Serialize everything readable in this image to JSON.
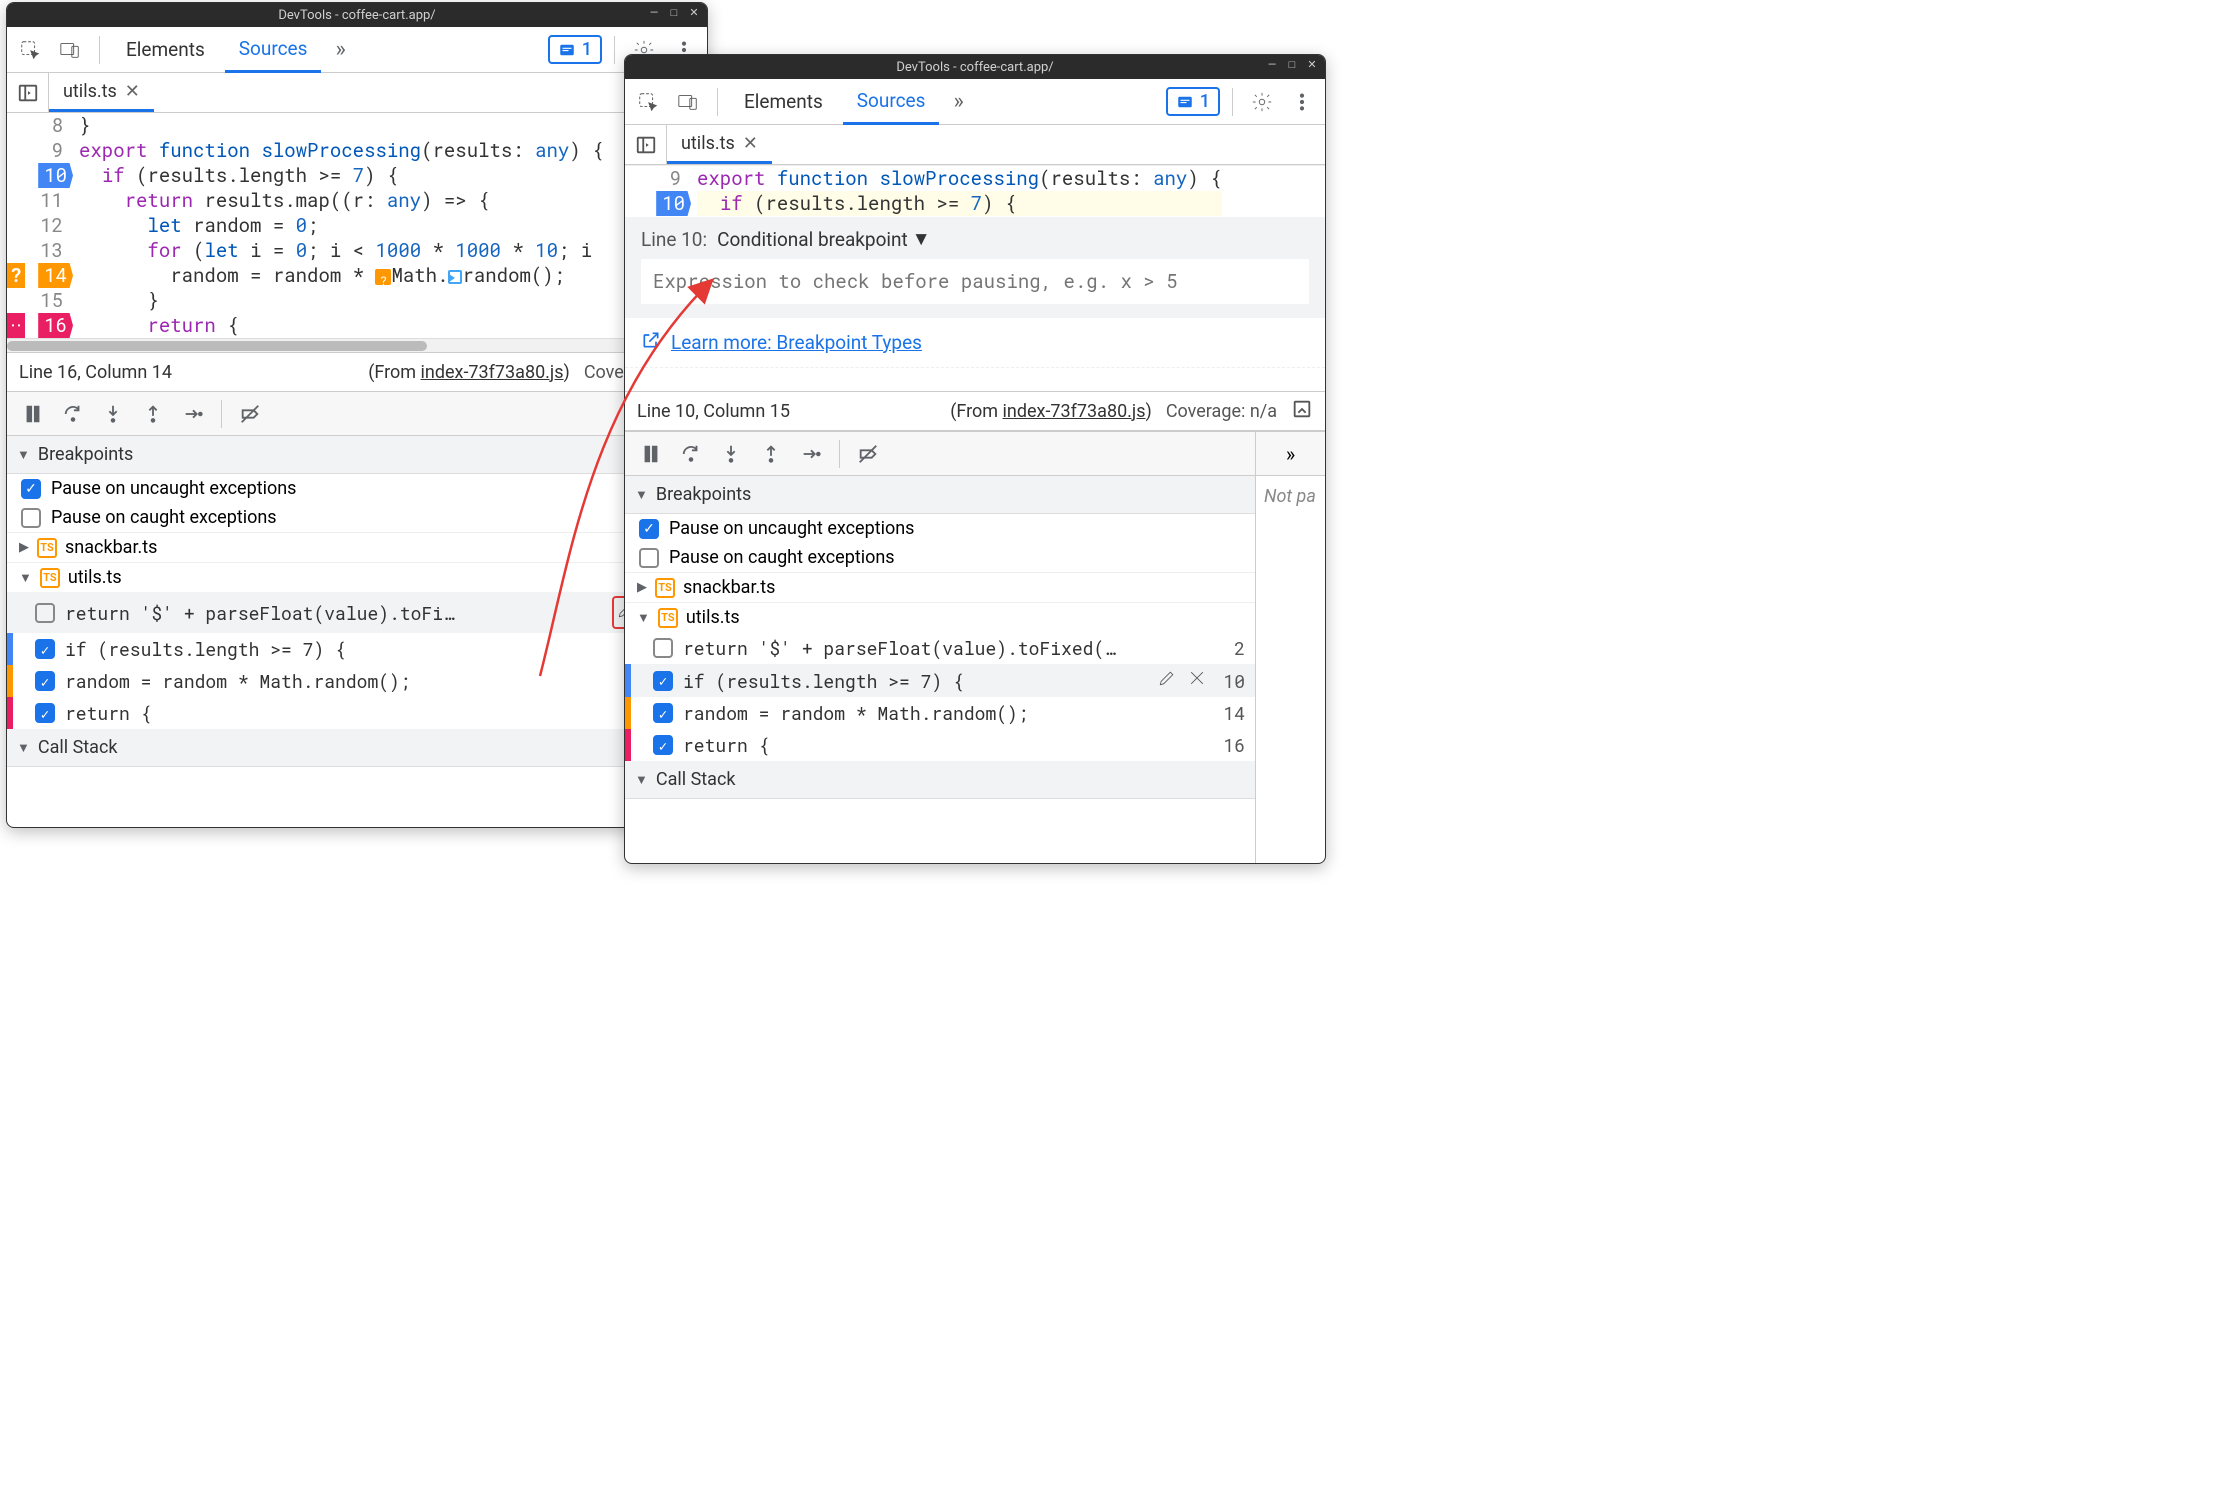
{
  "title": "DevTools - coffee-cart.app/",
  "tabs": {
    "elements": "Elements",
    "sources": "Sources"
  },
  "issues_count": "1",
  "file_tab": "utils.ts",
  "w1": {
    "gutter": [
      "8",
      "9",
      "10",
      "11",
      "12",
      "13",
      "14",
      "15",
      "16"
    ],
    "status_pos": "Line 16, Column 14",
    "status_from": "index-73f73a80.js",
    "status_cov": "Coverage: n/a",
    "bp_edit_line": "2"
  },
  "w2": {
    "gutter": [
      "9",
      "10"
    ],
    "status_pos": "Line 10, Column 15",
    "status_from": "index-73f73a80.js",
    "status_cov": "Coverage: n/a",
    "bp_edit_line": "10",
    "editor_line_label": "Line 10:",
    "editor_type": "Conditional breakpoint",
    "editor_placeholder": "Expression to check before pausing, e.g. x > 5",
    "learn_more": "Learn more: Breakpoint Types",
    "right_pane": "Not pa"
  },
  "sections": {
    "breakpoints": "Breakpoints",
    "callstack": "Call Stack",
    "pause_uncaught": "Pause on uncaught exceptions",
    "pause_caught": "Pause on caught exceptions"
  },
  "files": {
    "snackbar": "snackbar.ts",
    "utils": "utils.ts"
  },
  "bps": {
    "bp1": "return '$' + parseFloat(value).toFi…",
    "bp1_long": "return '$' + parseFloat(value).toFixed(…",
    "bp1_ln": "2",
    "bp2": "if (results.length >= 7) {",
    "bp2_ln": "10",
    "bp3": "random = random * Math.random();",
    "bp3_ln": "14",
    "bp4": "return {",
    "bp4_ln": "16"
  },
  "from_prefix": "(From ",
  "from_suffix": ")"
}
